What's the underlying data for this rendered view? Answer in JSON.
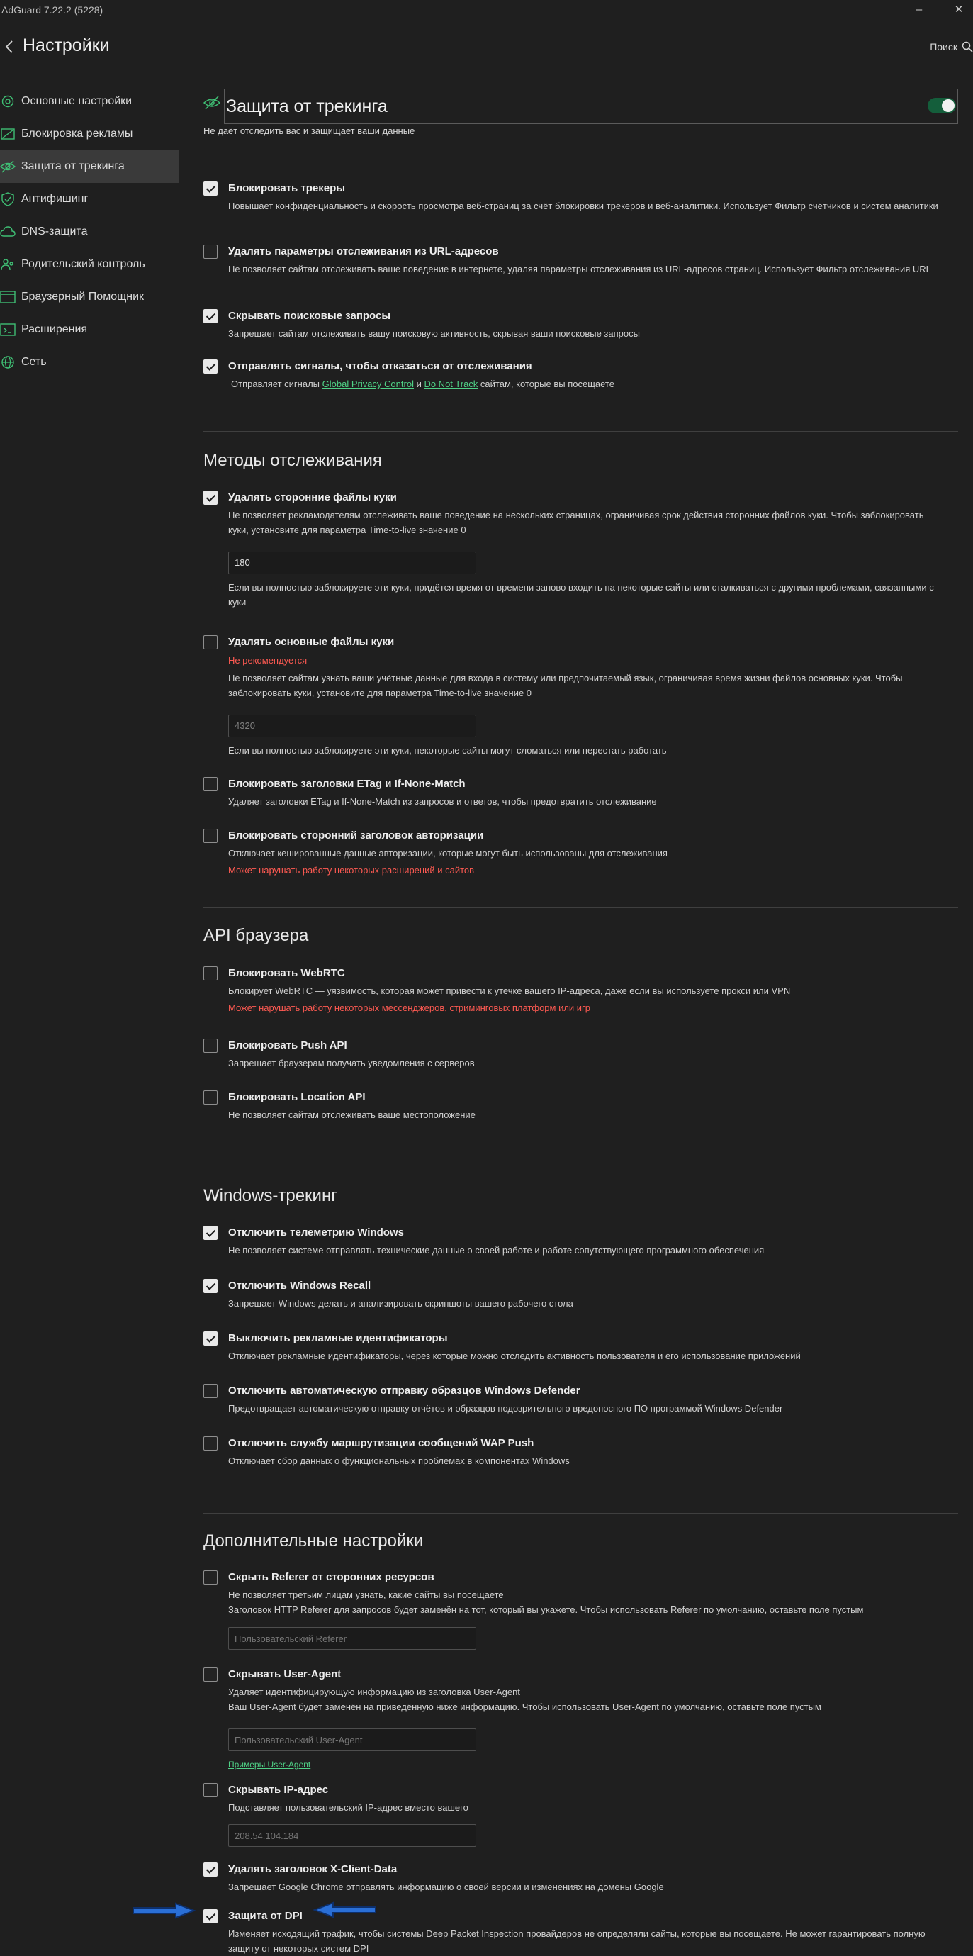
{
  "window": {
    "title": "AdGuard 7.22.2 (5228)",
    "minimize": "–",
    "close": "✕"
  },
  "header": {
    "title": "Настройки",
    "search_label": "Поиск"
  },
  "sidebar": {
    "items": [
      {
        "label": "Основные настройки",
        "icon": "gear-icon"
      },
      {
        "label": "Блокировка рекламы",
        "icon": "block-icon"
      },
      {
        "label": "Защита от трекинга",
        "icon": "eye-off-icon",
        "active": true
      },
      {
        "label": "Антифишинг",
        "icon": "shield-icon"
      },
      {
        "label": "DNS-защита",
        "icon": "cloud-icon"
      },
      {
        "label": "Родительский контроль",
        "icon": "parental-icon"
      },
      {
        "label": "Браузерный Помощник",
        "icon": "browser-icon"
      },
      {
        "label": "Расширения",
        "icon": "extensions-icon"
      },
      {
        "label": "Сеть",
        "icon": "globe-icon"
      }
    ]
  },
  "main": {
    "title": "Защита от трекинга",
    "enabled": true,
    "description": "Не даёт отследить вас и защищает ваши данные"
  },
  "tracking": {
    "block_trackers": {
      "title": "Блокировать трекеры",
      "checked": true,
      "desc": "Повышает конфиденциальность и скорость просмотра веб-страниц за счёт блокировки трекеров и веб-аналитики. Использует Фильтр счётчиков и систем аналитики"
    },
    "url_params": {
      "title": "Удалять параметры отслеживания из URL-адресов",
      "checked": false,
      "desc": "Не позволяет сайтам отслеживать ваше поведение в интернете, удаляя параметры отслеживания из URL-адресов страниц. Использует Фильтр отслеживания URL"
    },
    "hide_search": {
      "title": "Скрывать поисковые запросы",
      "checked": true,
      "desc": "Запрещает сайтам отслеживать вашу поисковую активность, скрывая ваши поисковые запросы"
    },
    "send_signals": {
      "title": "Отправлять сигналы, чтобы отказаться от отслеживания",
      "checked": true,
      "desc_prefix": "Отправляет сигналы ",
      "link1": "Global Privacy Control",
      "desc_and": " и ",
      "link2": "Do Not Track",
      "desc_suffix": " сайтам, которые вы посещаете"
    }
  },
  "methods": {
    "title": "Методы отслеживания",
    "third_party_cookies": {
      "title": "Удалять сторонние файлы куки",
      "checked": true,
      "desc": "Не позволяет рекламодателям отслеживать ваше поведение на нескольких страницах, ограничивая срок действия сторонних файлов куки. Чтобы заблокировать куки, установите для параметра Time-to-live значение 0",
      "value": "180",
      "note": "Если вы полностью заблокируете эти куки, придётся время от времени заново входить на некоторые сайты или сталкиваться с другими проблемами, связанными с куки"
    },
    "first_party_cookies": {
      "title": "Удалять основные файлы куки",
      "checked": false,
      "warning": "Не рекомендуется",
      "desc": "Не позволяет сайтам узнать ваши учётные данные для входа в систему или предпочитаемый язык, ограничивая время жизни файлов основных куки. Чтобы заблокировать куки, установите для параметра Time-to-live значение 0",
      "value": "4320",
      "note": "Если вы полностью заблокируете эти куки, некоторые сайты могут сломаться или перестать работать"
    },
    "etag": {
      "title": "Блокировать заголовки ETag и If-None-Match",
      "checked": false,
      "desc": "Удаляет заголовки ETag и If-None-Match из запросов и ответов, чтобы предотвратить отслеживание"
    },
    "auth_header": {
      "title": "Блокировать сторонний заголовок авторизации",
      "checked": false,
      "desc": "Отключает кешированные данные авторизации, которые могут быть использованы для отслеживания",
      "warning": "Может нарушать работу некоторых расширений и сайтов"
    }
  },
  "browser_api": {
    "title": "API браузера",
    "webrtc": {
      "title": "Блокировать WebRTC",
      "checked": false,
      "desc": "Блокирует WebRTC — уязвимость, которая может привести к утечке вашего IP-адреса, даже если вы используете прокси или VPN",
      "warning": "Может нарушать работу некоторых мессенджеров, стриминговых платформ или игр"
    },
    "push": {
      "title": "Блокировать Push API",
      "checked": false,
      "desc": "Запрещает браузерам получать уведомления с серверов"
    },
    "location": {
      "title": "Блокировать Location API",
      "checked": false,
      "desc": "Не позволяет сайтам отслеживать ваше местоположение"
    }
  },
  "windows": {
    "title": "Windows-трекинг",
    "telemetry": {
      "title": "Отключить телеметрию Windows",
      "checked": true,
      "desc": "Не позволяет системе отправлять технические данные о своей работе и работе сопутствующего программного обеспечения"
    },
    "recall": {
      "title": "Отключить Windows Recall",
      "checked": true,
      "desc": "Запрещает Windows делать и анализировать скриншоты вашего рабочего стола"
    },
    "ad_ids": {
      "title": "Выключить рекламные идентификаторы",
      "checked": true,
      "desc": "Отключает рекламные идентификаторы, через которые можно отследить активность пользователя и его использование приложений"
    },
    "defender": {
      "title": "Отключить автоматическую отправку образцов Windows Defender",
      "checked": false,
      "desc": "Предотвращает автоматическую отправку отчётов и образцов подозрительного вредоносного ПО программой Windows Defender"
    },
    "wap": {
      "title": "Отключить службу маршрутизации сообщений WAP Push",
      "checked": false,
      "desc": "Отключает сбор данных о функциональных проблемах в компонентах Windows"
    }
  },
  "advanced": {
    "title": "Дополнительные настройки",
    "referer": {
      "title": "Скрыть Referer от сторонних ресурсов",
      "checked": false,
      "desc": "Не позволяет третьим лицам узнать, какие сайты вы посещаете",
      "desc2": "Заголовок HTTP Referer для запросов будет заменён на тот, который вы укажете. Чтобы использовать Referer по умолчанию, оставьте поле пустым",
      "placeholder": "Пользовательский Referer"
    },
    "user_agent": {
      "title": "Скрывать User-Agent",
      "checked": false,
      "desc": "Удаляет идентифицирующую информацию из заголовка User-Agent",
      "desc2": "Ваш User-Agent будет заменён на приведённую ниже информацию. Чтобы использовать User-Agent по умолчанию, оставьте поле пустым",
      "placeholder": "Пользовательский User-Agent",
      "link": "Примеры User-Agent"
    },
    "ip": {
      "title": "Скрывать IP-адрес",
      "checked": false,
      "desc": "Подставляет пользовательский IP-адрес вместо вашего",
      "placeholder": "208.54.104.184"
    },
    "x_client": {
      "title": "Удалять заголовок X-Client-Data",
      "checked": true,
      "desc": "Запрещает Google Chrome отправлять информацию о своей версии и изменениях на домены Google"
    },
    "dpi": {
      "title": "Защита от DPI",
      "checked": true,
      "desc": "Изменяет исходящий трафик, чтобы системы Deep Packet Inspection провайдеров не определяли сайты, которые вы посещаете. Не может гарантировать полную защиту от некоторых систем DPI"
    }
  },
  "colors": {
    "accent": "#4fd186",
    "warning": "#ff5a52",
    "annotation": "#2a6fd6",
    "toggle_on": "#145e3b"
  }
}
